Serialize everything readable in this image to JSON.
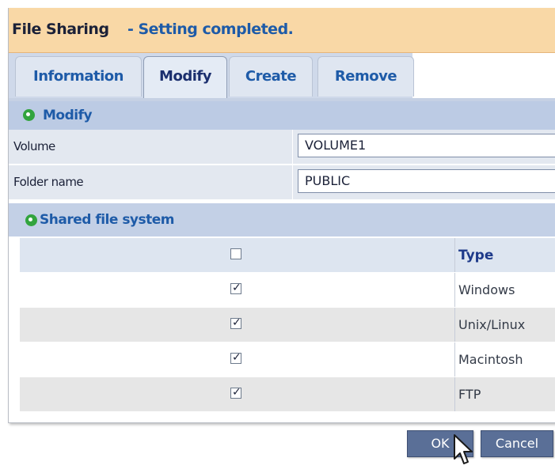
{
  "title": {
    "app": "File Sharing",
    "status": "- Setting completed."
  },
  "tabs": [
    {
      "label": "Information",
      "active": false
    },
    {
      "label": "Modify",
      "active": true
    },
    {
      "label": "Create",
      "active": false
    },
    {
      "label": "Remove",
      "active": false
    }
  ],
  "modify_section": {
    "heading": "Modify",
    "volume_label": "Volume",
    "volume_value": "VOLUME1",
    "folder_label": "Folder name",
    "folder_value": "PUBLIC"
  },
  "shared_section": {
    "heading": "Shared file system",
    "column_type": "Type",
    "rows": [
      {
        "type": "Windows",
        "checked": true
      },
      {
        "type": "Unix/Linux",
        "checked": true
      },
      {
        "type": "Macintosh",
        "checked": true
      },
      {
        "type": "FTP",
        "checked": true
      }
    ]
  },
  "buttons": {
    "ok": "OK",
    "cancel": "Cancel"
  },
  "colors": {
    "title_bg": "#f9d8a6",
    "accent_blue": "#1e5ba8",
    "section_bg": "#bccbe4",
    "button_bg": "#5a6f97",
    "green_bullet": "#32a43e"
  }
}
